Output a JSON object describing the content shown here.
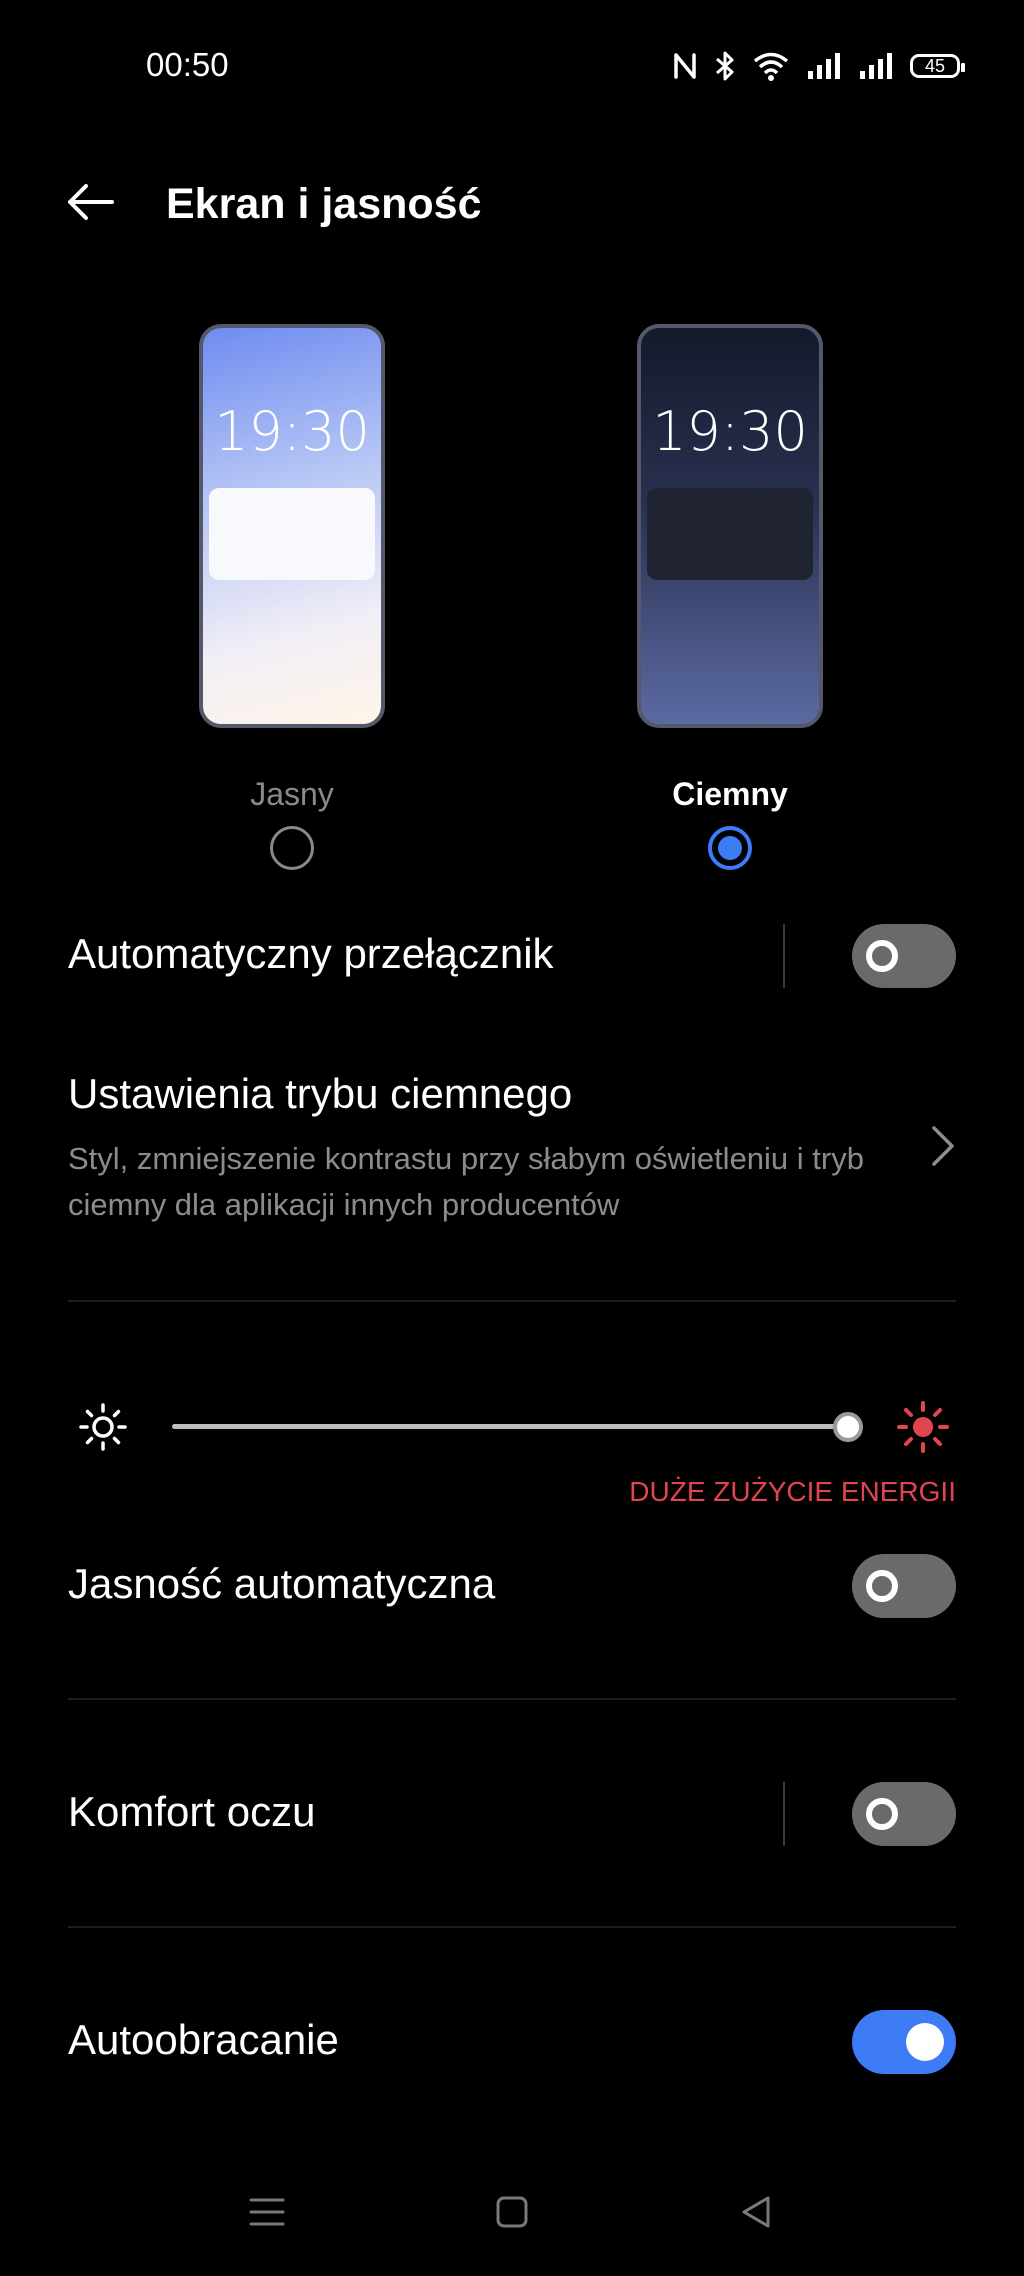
{
  "status_bar": {
    "time": "00:50",
    "battery": "45",
    "icons": [
      "nfc-icon",
      "bluetooth-icon",
      "wifi-icon",
      "signal-icon",
      "signal-icon",
      "battery-icon"
    ]
  },
  "header": {
    "title": "Ekran i jasność",
    "back_icon": "arrow-left-icon"
  },
  "theme": {
    "light": {
      "preview_time": "19:30",
      "label": "Jasny",
      "selected": false
    },
    "dark": {
      "preview_time": "19:30",
      "label": "Ciemny",
      "selected": true
    }
  },
  "rows": {
    "auto_switch": {
      "label": "Automatyczny przełącznik",
      "enabled": false
    },
    "dark_mode_settings": {
      "label": "Ustawienia trybu ciemnego",
      "description": "Styl, zmniejszenie kontrastu przy słabym oświetleniu i tryb ciemny dla aplikacji innych producentów"
    },
    "auto_brightness": {
      "label": "Jasność automatyczna",
      "enabled": false
    },
    "eye_comfort": {
      "label": "Komfort oczu",
      "enabled": false
    },
    "auto_rotate": {
      "label": "Autoobracanie",
      "enabled": true
    }
  },
  "brightness": {
    "level": 1.0,
    "warning": "DUŻE ZUŻYCIE ENERGII"
  },
  "colors": {
    "accent": "#3d7cf5",
    "warning": "#e0464e",
    "background": "#000000"
  },
  "nav_bar": [
    "menu-icon",
    "home-icon",
    "back-triangle-icon"
  ]
}
